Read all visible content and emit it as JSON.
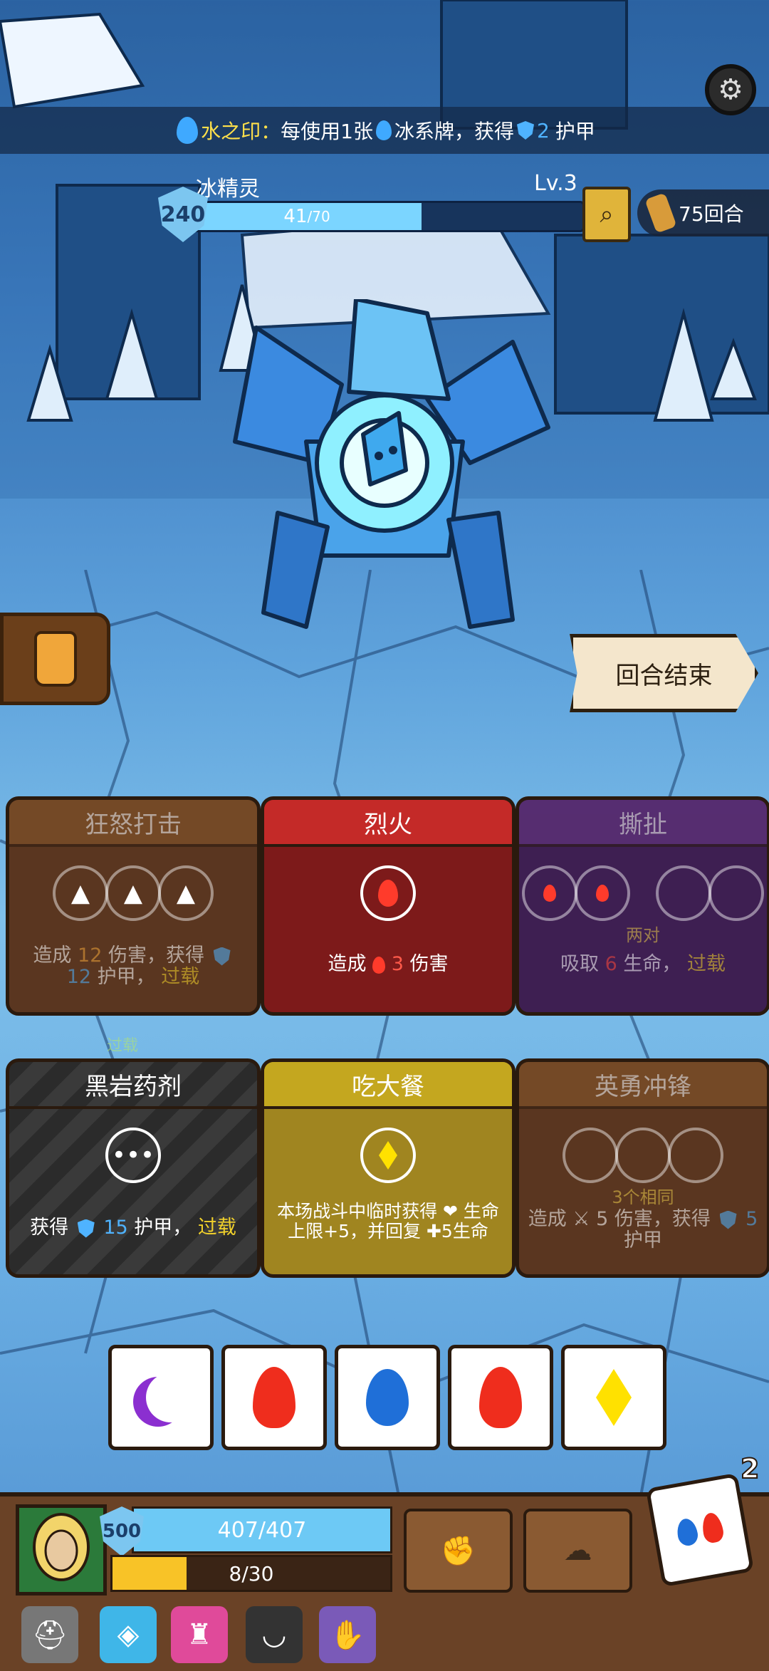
{
  "banner": {
    "prefix": "水之印：",
    "text_a": "每使用1张",
    "text_b": "冰系牌，获得",
    "armor_value": "2",
    "text_c": "护甲"
  },
  "enemy": {
    "name": "冰精灵",
    "level": "Lv.3",
    "armor": "240",
    "hp_current": "41",
    "hp_max": "/70",
    "hp_fraction": 0.586
  },
  "rounds": {
    "label": "75回合"
  },
  "end_turn": {
    "label": "回合结束"
  },
  "cards": [
    {
      "title": "狂怒打击",
      "desc_a": "造成",
      "value": "12",
      "desc_b": "伤害，获得",
      "value2": "12",
      "desc_c": "护甲，",
      "keyword": "过载"
    },
    {
      "title": "烈火",
      "desc_a": "造成",
      "value": "3",
      "desc_b": "伤害"
    },
    {
      "title": "撕扯",
      "req": "两对",
      "desc_a": "吸取",
      "value": "6",
      "desc_b": "生命，",
      "keyword": "过载"
    },
    {
      "title": "黑岩药剂",
      "desc_a": "获得",
      "value": "15",
      "desc_b": "护甲，",
      "keyword": "过载",
      "overload_tag": "过载"
    },
    {
      "title": "吃大餐",
      "desc": "本场战斗中临时获得 ❤ 生命上限+5，并回复 ✚5生命"
    },
    {
      "title": "英勇冲锋",
      "req": "3个相同",
      "desc_a": "造成",
      "value": "5",
      "desc_b": "伤害，获得",
      "value2": "5",
      "desc_c": "护甲"
    }
  ],
  "dice": [
    "moon",
    "fire",
    "water",
    "fire",
    "diamond"
  ],
  "player": {
    "armor": "500",
    "hp": "407/407",
    "energy": "8/30",
    "energy_fraction": 0.267
  },
  "rolls_left": "2",
  "colors": {
    "accent_yellow": "#f1d12b",
    "hp_blue": "#6dc9f5",
    "energy_yellow": "#f8c327"
  }
}
